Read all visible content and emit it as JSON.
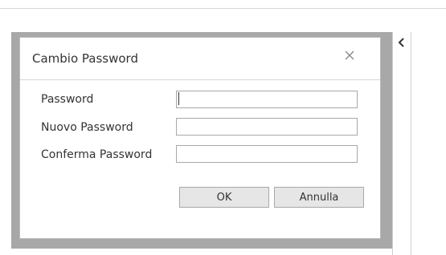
{
  "dialog": {
    "title": "Cambio Password",
    "close_icon": "close-icon",
    "fields": [
      {
        "label": "Password",
        "value": ""
      },
      {
        "label": "Nuovo Password",
        "value": ""
      },
      {
        "label": "Conferma Password",
        "value": ""
      }
    ],
    "buttons": {
      "ok_label": "OK",
      "cancel_label": "Annulla"
    }
  },
  "side_panel": {
    "collapse_icon": "chevron-left-icon"
  },
  "colors": {
    "overlay": "#a8a8a8",
    "dialog_bg": "#ffffff",
    "button_bg": "#e6e6e6",
    "text": "#333333"
  }
}
